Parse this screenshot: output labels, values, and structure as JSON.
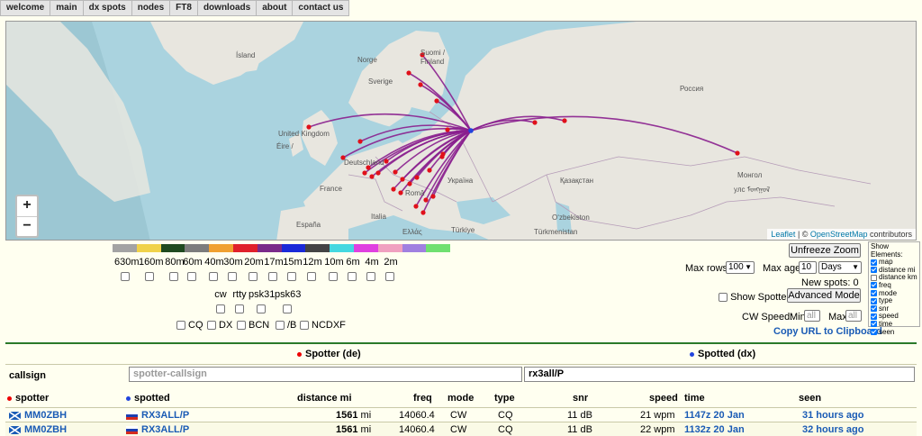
{
  "nav": [
    "welcome",
    "main",
    "dx spots",
    "nodes",
    "FT8",
    "downloads",
    "about",
    "contact us"
  ],
  "map": {
    "labels": [
      {
        "name": "island",
        "text": "Ísland"
      },
      {
        "name": "norge",
        "text": "Norge"
      },
      {
        "name": "suomi",
        "text": "Suomi /"
      },
      {
        "name": "finland",
        "text": "Finland"
      },
      {
        "name": "sverige",
        "text": "Sverige"
      },
      {
        "name": "rossiya",
        "text": "Россия"
      },
      {
        "name": "uk",
        "text": "United Kingdom"
      },
      {
        "name": "eire",
        "text": "Éire /"
      },
      {
        "name": "deutschland",
        "text": "Deutschland"
      },
      {
        "name": "ukraina",
        "text": "Україна"
      },
      {
        "name": "kazakhstan",
        "text": "Қазақстан"
      },
      {
        "name": "mongol",
        "text": "Монгол"
      },
      {
        "name": "mongol2",
        "text": "улс ᠮᠣᠩᠭᠣᠯ"
      },
      {
        "name": "france",
        "text": "France"
      },
      {
        "name": "roma",
        "text": "Româ"
      },
      {
        "name": "italia",
        "text": "Italia"
      },
      {
        "name": "espana",
        "text": "España"
      },
      {
        "name": "ellas",
        "text": "Ελλάς"
      },
      {
        "name": "turkiye",
        "text": "Türkiye"
      },
      {
        "name": "uzbekiston",
        "text": "O‘zbekiston"
      },
      {
        "name": "turkmenistan",
        "text": "Türkmenistan"
      }
    ],
    "zoom_in": "+",
    "zoom_out": "−",
    "attribution_leaflet": "Leaflet",
    "attribution_sep": " | © ",
    "attribution_osm": "OpenStreetMap",
    "attribution_tail": " contributors"
  },
  "bands": {
    "colors": [
      "#a3a3a3",
      "#f0d24a",
      "#1f4a1f",
      "#7c7c7c",
      "#f0a030",
      "#e0202a",
      "#7a2a8a",
      "#1a2ad8",
      "#444444",
      "#44d8e0",
      "#e040e0",
      "#f0a0c0",
      "#a080e0",
      "#70e070"
    ],
    "labels": [
      "630m",
      "160m",
      "80m",
      "60m",
      "40m",
      "30m",
      "20m",
      "17m",
      "15m",
      "12m",
      "10m",
      "6m",
      "4m",
      "2m"
    ],
    "modes": [
      "cw",
      "rtty",
      "psk31",
      "psk63"
    ],
    "types": [
      "CQ",
      "DX",
      "BCN",
      "/B",
      "NCDXF"
    ]
  },
  "controls": {
    "unfreeze": "Unfreeze Zoom",
    "max_rows_label": "Max rows:",
    "max_rows_value": "100",
    "max_age_label": "Max age:",
    "max_age_value": "10",
    "max_age_unit": "Days",
    "new_spots": "New spots: 0",
    "show_spotters": "Show Spotters",
    "advanced": "Advanced Mode",
    "cw_speed": "CW Speed:",
    "min": "Min",
    "max": "Max",
    "all": "all",
    "copy_url": "Copy URL to Clipboard"
  },
  "elements": {
    "title": "Show Elements:",
    "items": [
      {
        "label": "map",
        "on": true
      },
      {
        "label": "distance mi",
        "on": true
      },
      {
        "label": "distance km",
        "on": false
      },
      {
        "label": "freq",
        "on": true
      },
      {
        "label": "mode",
        "on": true
      },
      {
        "label": "type",
        "on": true
      },
      {
        "label": "snr",
        "on": true
      },
      {
        "label": "speed",
        "on": true
      },
      {
        "label": "time",
        "on": true
      },
      {
        "label": "seen",
        "on": true
      }
    ]
  },
  "table": {
    "spotter_de": "Spotter (de)",
    "spotted_dx": "Spotted (dx)",
    "callsign_label": "callsign",
    "spotter_placeholder": "spotter-callsign",
    "spotted_value": "rx3all/P",
    "headers": {
      "spotter": "spotter",
      "spotted": "spotted",
      "distance": "distance mi",
      "freq": "freq",
      "mode": "mode",
      "type": "type",
      "snr": "snr",
      "speed": "speed",
      "time": "time",
      "seen": "seen"
    },
    "rows": [
      {
        "spotter": "MM0ZBH",
        "spotted": "RX3ALL/P",
        "distance": "1561",
        "unit": "mi",
        "freq": "14060.4",
        "mode": "CW",
        "type": "CQ",
        "snr": "11 dB",
        "speed": "21 wpm",
        "time": "1147z 20 Jan",
        "seen": "31 hours ago"
      },
      {
        "spotter": "MM0ZBH",
        "spotted": "RX3ALL/P",
        "distance": "1561",
        "unit": "mi",
        "freq": "14060.4",
        "mode": "CW",
        "type": "CQ",
        "snr": "11 dB",
        "speed": "22 wpm",
        "time": "1132z 20 Jan",
        "seen": "32 hours ago"
      }
    ]
  }
}
